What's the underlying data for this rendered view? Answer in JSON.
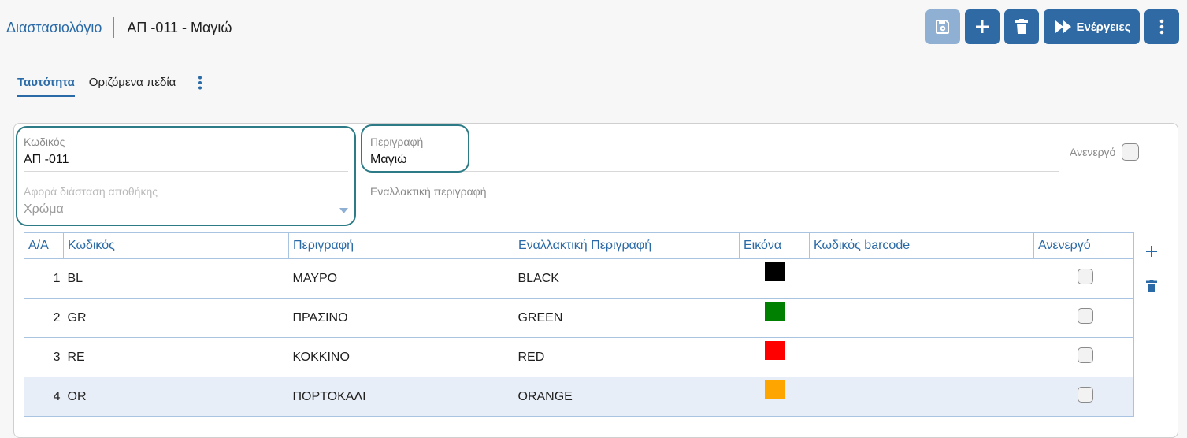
{
  "breadcrumb": {
    "link": "Διαστασιολόγιο",
    "title": "ΑΠ -011 - Μαγιώ"
  },
  "toolbar": {
    "actions_label": "Ενέργειες"
  },
  "tabs": [
    {
      "label": "Ταυτότητα"
    },
    {
      "label": "Οριζόμενα πεδία"
    }
  ],
  "form": {
    "code_label": "Κωδικός",
    "code_value": "ΑΠ -011",
    "description_label": "Περιγραφή",
    "description_value": "Μαγιώ",
    "inactive_label": "Ανενεργό",
    "warehouse_dim_label": "Αφορά διάσταση αποθήκης",
    "warehouse_dim_value": "Χρώμα",
    "alt_description_label": "Εναλλακτική περιγραφή",
    "alt_description_value": ""
  },
  "grid": {
    "columns": [
      "Α/Α",
      "Κωδικός",
      "Περιγραφή",
      "Εναλλακτική Περιγραφή",
      "Εικόνα",
      "Κωδικός barcode",
      "Ανενεργό"
    ],
    "rows": [
      {
        "aa": "1",
        "code": "BL",
        "desc": "ΜΑΥΡΟ",
        "alt": "BLACK",
        "color": "#000000",
        "barcode": ""
      },
      {
        "aa": "2",
        "code": "GR",
        "desc": "ΠΡΑΣΙΝΟ",
        "alt": "GREEN",
        "color": "#008000",
        "barcode": ""
      },
      {
        "aa": "3",
        "code": "RE",
        "desc": "ΚΟΚΚΙΝΟ",
        "alt": "RED",
        "color": "#ff0000",
        "barcode": ""
      },
      {
        "aa": "4",
        "code": "OR",
        "desc": "ΠΟΡΤΟΚΑΛΙ",
        "alt": "ORANGE",
        "color": "#ffa500",
        "barcode": ""
      }
    ]
  },
  "colors": {
    "accent": "#2f6aa5",
    "highlight_border": "#2d7b86",
    "selected_row": "#e8eef7"
  }
}
